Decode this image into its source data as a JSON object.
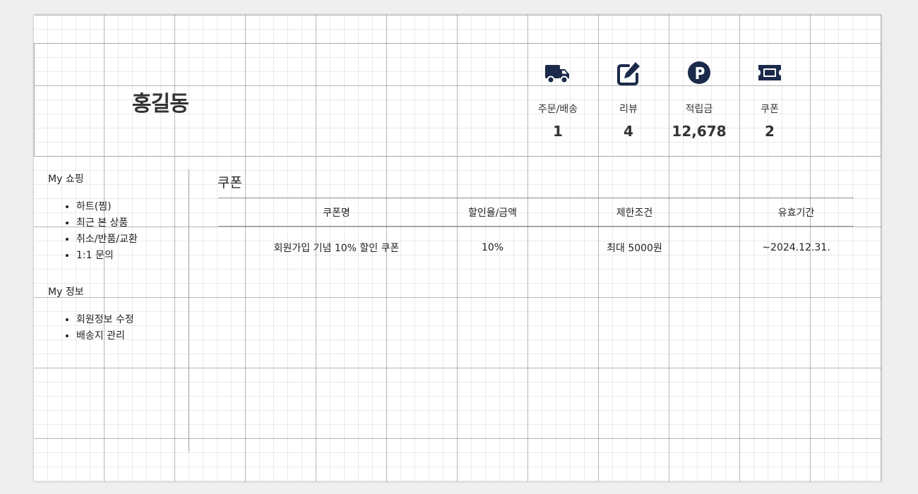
{
  "user": {
    "name": "홍길동"
  },
  "stats": [
    {
      "icon": "truck-icon",
      "label": "주문/배송",
      "value": "1"
    },
    {
      "icon": "pencil-square-icon",
      "label": "리뷰",
      "value": "4"
    },
    {
      "icon": "points-p-icon",
      "label": "적립금",
      "value": "12,678"
    },
    {
      "icon": "ticket-icon",
      "label": "쿠폰",
      "value": "2"
    }
  ],
  "sidebar": {
    "groups": [
      {
        "title": "My 쇼핑",
        "items": [
          "하트(찜)",
          "최근 본 상품",
          "취소/반품/교환",
          "1:1 문의"
        ]
      },
      {
        "title": "My 정보",
        "items": [
          "회원정보 수정",
          "배송지 관리"
        ]
      }
    ]
  },
  "content": {
    "title": "쿠폰",
    "columns": [
      "쿠폰명",
      "할인율/금액",
      "제한조건",
      "유효기간"
    ],
    "rows": [
      [
        "회원가입 기념 10% 할인 쿠폰",
        "10%",
        "최대 5000원",
        "~2024.12.31."
      ]
    ]
  },
  "colors": {
    "icon": "#1b2a4a",
    "grid_major": "#b0b0b0",
    "grid_minor": "#e0e0e0"
  }
}
